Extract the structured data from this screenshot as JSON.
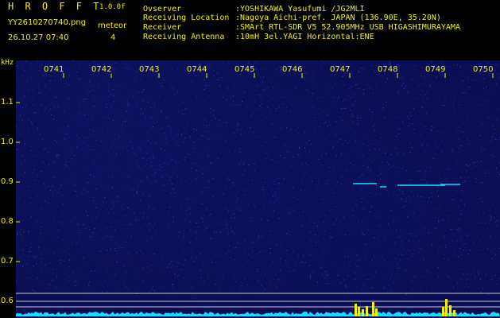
{
  "header": {
    "program_title": "H R O F F T",
    "version": "1.0.0f",
    "filename": "YY2610270740.png",
    "datetime": "26.10.27 07:40",
    "meteor_label": "meteor",
    "meteor_count": "4",
    "info": [
      {
        "label": "Ovserver",
        "value": ":YOSHIKAWA Yasufumi /JG2MLI"
      },
      {
        "label": "Receiving Location",
        "value": ":Nagoya Aichi-pref. JAPAN (136.90E, 35.20N)"
      },
      {
        "label": "Receiver",
        "value": ":SMArt RTL-SDR V5 52.905MHz USB HIGASHIMURAYAMA"
      },
      {
        "label": "Receiving Antenna",
        "value": ":10mH 3el.YAGI Horizontal:ENE"
      }
    ]
  },
  "axis": {
    "unit": "kHz",
    "time_ticks": [
      "0741",
      "0742",
      "0743",
      "0744",
      "0745",
      "0746",
      "0747",
      "0748",
      "0749",
      "0750"
    ],
    "freq_ticks": [
      "1.1",
      "1.0",
      "0.9",
      "0.8",
      "0.7",
      "0.6"
    ]
  },
  "colors": {
    "label": "#f5f200",
    "background": "#0b0e52",
    "grid_line": "#c8c8c8",
    "echo": "#00e5ff",
    "spectrum": "#00e8ff",
    "spectrum_peak": "#f5f200"
  }
}
